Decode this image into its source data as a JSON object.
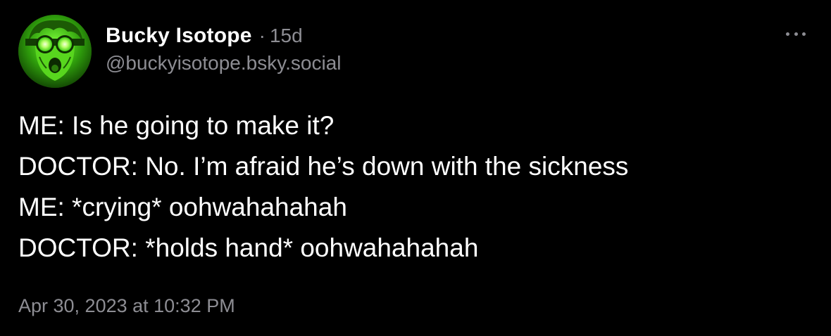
{
  "author": {
    "display_name": "Bucky Isotope",
    "separator": "·",
    "age": "15d",
    "handle": "@buckyisotope.bsky.social",
    "avatar_icon": "glowing-goggles-face-avatar",
    "avatar_color": "#4cff2a"
  },
  "menu": {
    "icon": "more-horizontal-icon"
  },
  "post": {
    "lines": [
      "ME: Is he going to make it?",
      "DOCTOR: No. I’m afraid he’s down with the sickness",
      "ME: *crying* oohwahahahah",
      "DOCTOR: *holds hand* oohwahahahah"
    ],
    "timestamp": "Apr 30, 2023 at 10:32 PM"
  },
  "colors": {
    "background": "#000000",
    "text": "#ffffff",
    "muted": "#8d8d93"
  }
}
